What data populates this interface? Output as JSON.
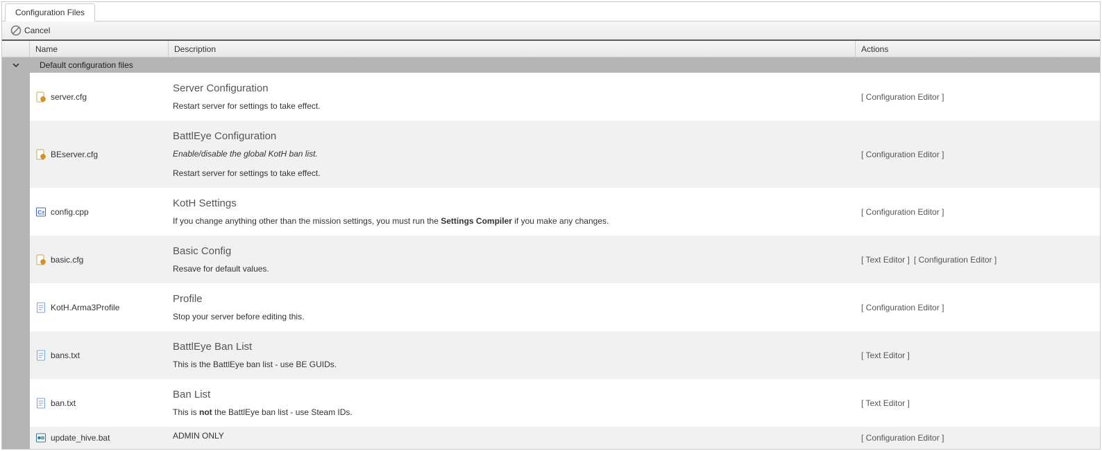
{
  "tab": {
    "label": "Configuration Files"
  },
  "toolbar": {
    "cancel_label": "Cancel"
  },
  "columns": {
    "name": "Name",
    "description": "Description",
    "actions": "Actions"
  },
  "group": {
    "label": "Default configuration files"
  },
  "rows": [
    {
      "icon": "cfg",
      "name": "server.cfg",
      "title": "Server Configuration",
      "desc_html": "Restart server for settings to take effect.",
      "actions": [
        "[ Configuration Editor ]"
      ]
    },
    {
      "icon": "cfg",
      "name": "BEserver.cfg",
      "title": "BattlEye Configuration",
      "desc_html": "<em>Enable/disable the global KotH ban list.</em><br><br>Restart server for settings to take effect.",
      "actions": [
        "[ Configuration Editor ]"
      ]
    },
    {
      "icon": "cpp",
      "name": "config.cpp",
      "title": "KotH Settings",
      "desc_html": "If you change anything other than the mission settings, you must run the <b>Settings Compiler</b> if you make any changes.",
      "actions": [
        "[ Configuration Editor ]"
      ]
    },
    {
      "icon": "cfg",
      "name": "basic.cfg",
      "title": "Basic Config",
      "desc_html": "Resave for default values.",
      "actions": [
        "[ Text Editor ]",
        "[ Configuration Editor ]"
      ]
    },
    {
      "icon": "txt",
      "name": "KotH.Arma3Profile",
      "title": "Profile",
      "desc_html": "Stop your server before editing this.",
      "actions": [
        "[ Configuration Editor ]"
      ]
    },
    {
      "icon": "txt",
      "name": "bans.txt",
      "title": "BattlEye Ban List",
      "desc_html": "This is the BattlEye ban list - use BE GUIDs.",
      "actions": [
        "[ Text Editor ]"
      ]
    },
    {
      "icon": "txt",
      "name": "ban.txt",
      "title": "Ban List",
      "desc_html": "This is <b>not</b> the BattlEye ban list - use Steam IDs.",
      "actions": [
        "[ Text Editor ]"
      ]
    },
    {
      "icon": "bat",
      "name": "update_hive.bat",
      "title": "",
      "desc_html": "ADMIN ONLY",
      "compact": true,
      "actions": [
        "[ Configuration Editor ]"
      ]
    }
  ]
}
